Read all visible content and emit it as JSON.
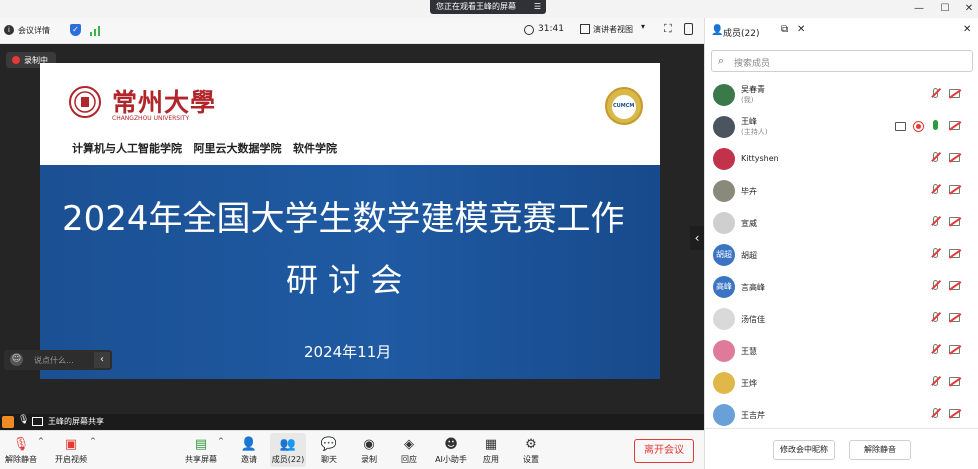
{
  "banner": {
    "text": "您正在观看王峰的屏幕",
    "menu_icon": "menu-icon"
  },
  "toolbar": {
    "meeting_info": "会议详情",
    "timer": "31:41",
    "view_mode": "演讲者视图"
  },
  "recording_badge": "录制中",
  "slide": {
    "university_cn": "常州大學",
    "university_en": "CHANGZHOU UNIVERSITY",
    "schools": "计算机与人工智能学院   阿里云大数据学院   软件学院",
    "logo_right": "CUMCM",
    "title_line1": "2024年全国大学生数学建模竞赛工作",
    "title_line2": "研 讨 会",
    "date": "2024年11月"
  },
  "chat_input": {
    "placeholder": "说点什么..."
  },
  "share_bar": {
    "text": "王峰的屏幕共享"
  },
  "bottom_bar": {
    "mute": "解除静音",
    "video": "开启视频",
    "share": "共享屏幕",
    "invite": "邀请",
    "members": "成员(22)",
    "chat": "聊天",
    "record": "录制",
    "chapters": "回应",
    "ai": "AI小助手",
    "apps": "应用",
    "settings": "设置",
    "leave": "离开会议"
  },
  "panel": {
    "title": "成员(22)",
    "search_placeholder": "搜索成员",
    "members": [
      {
        "name": "吴春青",
        "role": "(我)",
        "avatar_color": "#3a7a4a"
      },
      {
        "name": "王峰",
        "role": "(主持人)",
        "avatar_color": "#4a5560"
      },
      {
        "name": "Kittyshen",
        "role": "",
        "avatar_color": "#c2324a"
      },
      {
        "name": "毕卉",
        "role": "",
        "avatar_color": "#8a8a7a"
      },
      {
        "name": "宣威",
        "role": "",
        "avatar_color": "#cfcfcf"
      },
      {
        "name": "胡超",
        "role": "",
        "avatar_color": "#3c74c4",
        "avatar_text": "胡超"
      },
      {
        "name": "言高峰",
        "role": "",
        "avatar_color": "#3c74c4",
        "avatar_text": "高峰"
      },
      {
        "name": "汤信佳",
        "role": "",
        "avatar_color": "#d9d9d9"
      },
      {
        "name": "王慧",
        "role": "",
        "avatar_color": "#e07a9a"
      },
      {
        "name": "王烨",
        "role": "",
        "avatar_color": "#e0b84a"
      },
      {
        "name": "王吉芹",
        "role": "",
        "avatar_color": "#6aa0d8"
      }
    ],
    "rename_button": "修改会中昵称",
    "unmute_all_button": "解除静音"
  }
}
